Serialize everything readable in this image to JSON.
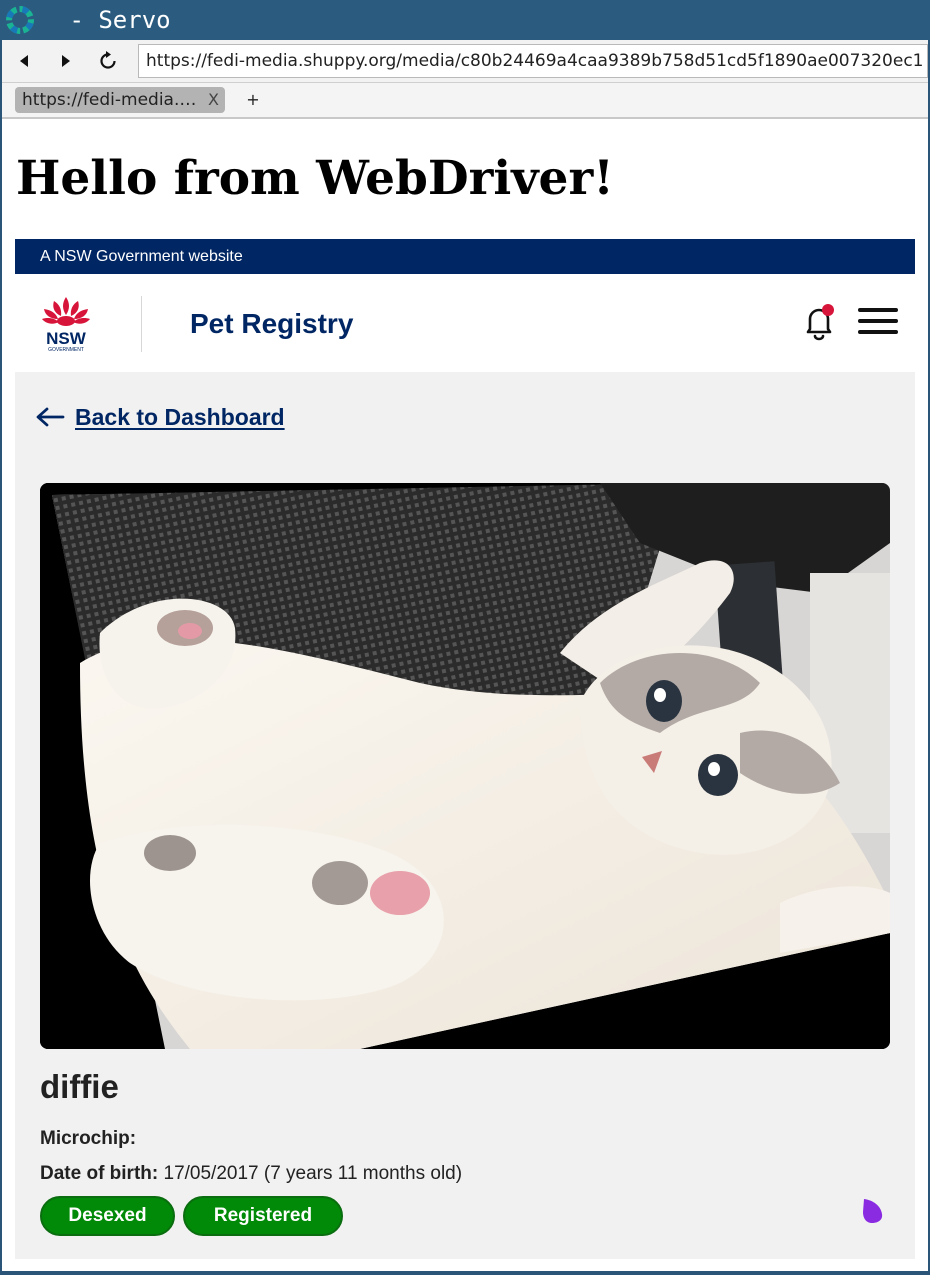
{
  "window": {
    "title": " - Servo"
  },
  "toolbar": {
    "back_icon": "back-arrow-icon",
    "forward_icon": "forward-arrow-icon",
    "reload_icon": "reload-icon",
    "url": "https://fedi-media.shuppy.org/media/c80b24469a4caa9389b758d51cd5f1890ae007320ec1"
  },
  "tabs": [
    {
      "label": "https://fedi-media.…",
      "close": "X"
    }
  ],
  "new_tab_label": "+",
  "page": {
    "heading": "Hello from WebDriver!",
    "screenshot": {
      "masthead": "A NSW Government website",
      "logo": {
        "text": "NSW",
        "subtext": "GOVERNMENT",
        "colors": {
          "waratah": "#d7153a",
          "text": "#002664"
        }
      },
      "site_name": "Pet Registry",
      "notification_icon": "bell-icon",
      "menu_icon": "hamburger-menu-icon",
      "back_link": "Back to Dashboard",
      "pet": {
        "name": "diffie",
        "microchip_label": "Microchip:",
        "microchip_value": "",
        "dob_label": "Date of birth:",
        "dob_value": "17/05/2017 (7 years 11 months old)",
        "badges": [
          "Desexed",
          "Registered"
        ]
      },
      "colors": {
        "nsw_blue": "#002664",
        "badge_green": "#008a07",
        "notification_red": "#d7153a",
        "blob_purple": "#8a2be2"
      }
    }
  }
}
